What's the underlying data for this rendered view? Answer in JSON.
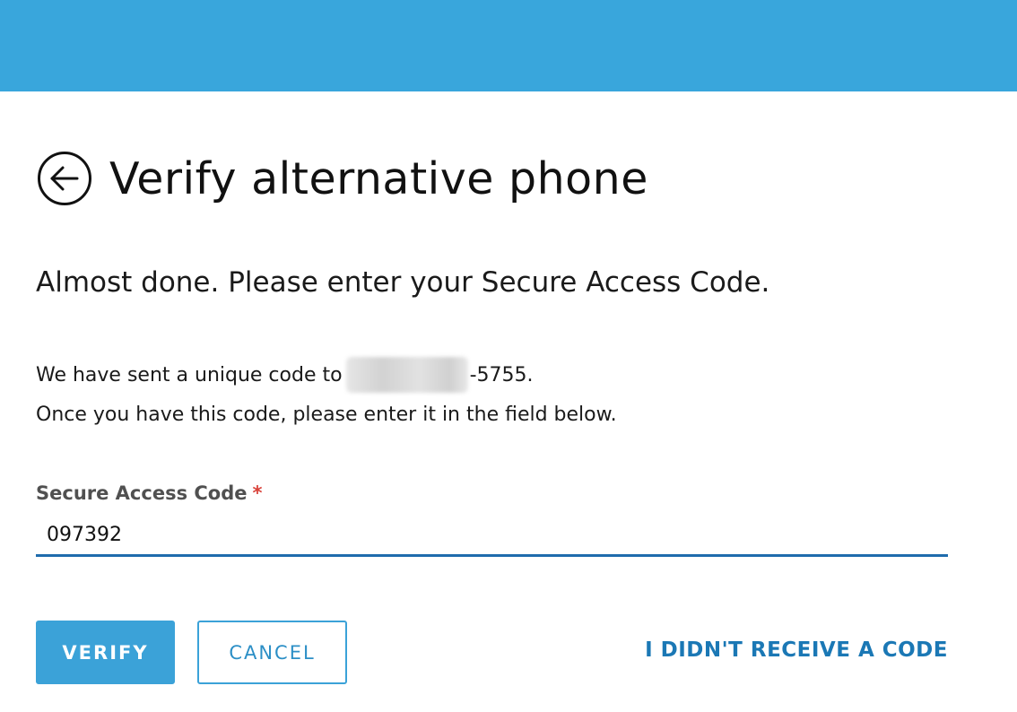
{
  "header": {
    "title": "Verify alternative phone",
    "back_icon": "arrow-left-circle-icon"
  },
  "content": {
    "subtitle": "Almost done. Please enter your Secure Access Code.",
    "sent_prefix": "We have sent a unique code to",
    "phone_suffix": "-5755.",
    "instruction": "Once you have this code, please enter it in the field below."
  },
  "form": {
    "label": "Secure Access Code",
    "required_marker": "*",
    "code_value": "097392"
  },
  "actions": {
    "verify_label": "VERIFY",
    "cancel_label": "CANCEL",
    "resend_label": "I DIDN'T RECEIVE A CODE"
  },
  "colors": {
    "top_bar": "#39a6dc",
    "primary_button": "#3ba2d8",
    "link": "#1b78b5",
    "input_underline": "#1f6cad",
    "required": "#d9433b"
  }
}
